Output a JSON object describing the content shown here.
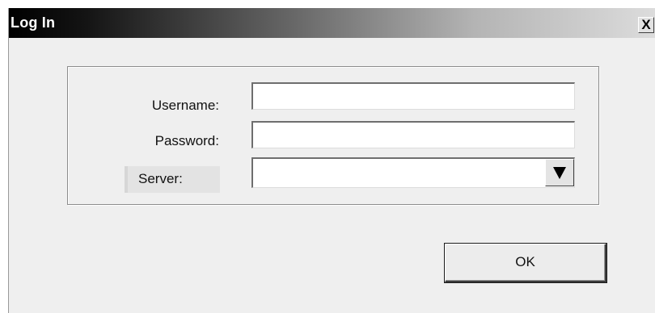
{
  "window": {
    "title": "Log In",
    "close_label": "X"
  },
  "form": {
    "username_label": "Username:",
    "username_value": "",
    "password_label": "Password:",
    "password_value": "",
    "server_label": "Server:",
    "server_value": ""
  },
  "buttons": {
    "ok_label": "OK"
  },
  "colors": {
    "titlebar_start": "#000000",
    "titlebar_end": "#dcdcdc",
    "window_bg": "#efefef"
  },
  "icons": {
    "dropdown": "triangle-down-icon",
    "close": "close-icon"
  }
}
